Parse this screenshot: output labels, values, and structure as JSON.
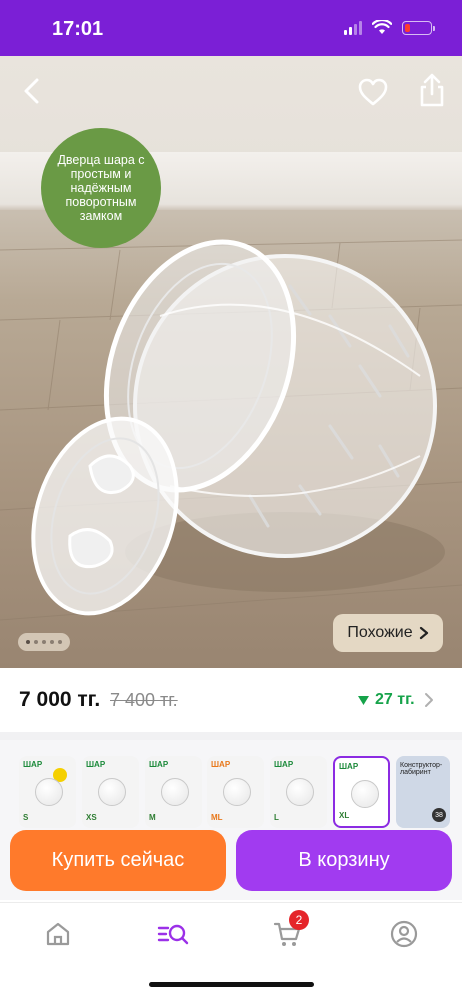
{
  "status_bar": {
    "time": "17:01",
    "icons": [
      "signal-icon",
      "wifi-icon",
      "battery-icon"
    ],
    "battery_color": "#ff3b30",
    "battery_level": 0.2
  },
  "hero": {
    "promo_text": "Дверца шара с простым и надёжным поворотным замком",
    "promo_color": "#6a9a45",
    "similar_label": "Похожие",
    "carousel": {
      "count": 5,
      "active": 0
    },
    "icons": [
      "back-icon",
      "heart-icon",
      "share-icon",
      "chevron-right-icon"
    ]
  },
  "price": {
    "current": "7 000 тг.",
    "old": "7 400 тг.",
    "diff": "27 тг.",
    "diff_color": "#16a34a"
  },
  "variants": {
    "items": [
      {
        "brand": "ШАР",
        "size": "S"
      },
      {
        "brand": "ШАР",
        "size": "XS"
      },
      {
        "brand": "ШАР",
        "size": "M"
      },
      {
        "brand": "ШАР",
        "size": "ML"
      },
      {
        "brand": "ШАР",
        "size": "L"
      },
      {
        "brand": "ШАР",
        "size": "XL"
      }
    ],
    "selected_index": 5,
    "special": {
      "label": "Конструктор-лабиринт",
      "number": "38"
    }
  },
  "actions": {
    "buy_now": "Купить сейчас",
    "add_to_cart": "В корзину",
    "buy_color": "#ff7a2b",
    "cart_color": "#a13bf0"
  },
  "tabbar": {
    "tabs": [
      "home-icon",
      "catalog-search-icon",
      "cart-icon",
      "profile-icon"
    ],
    "active_tab": "catalog-search-icon",
    "cart_count": "2"
  }
}
